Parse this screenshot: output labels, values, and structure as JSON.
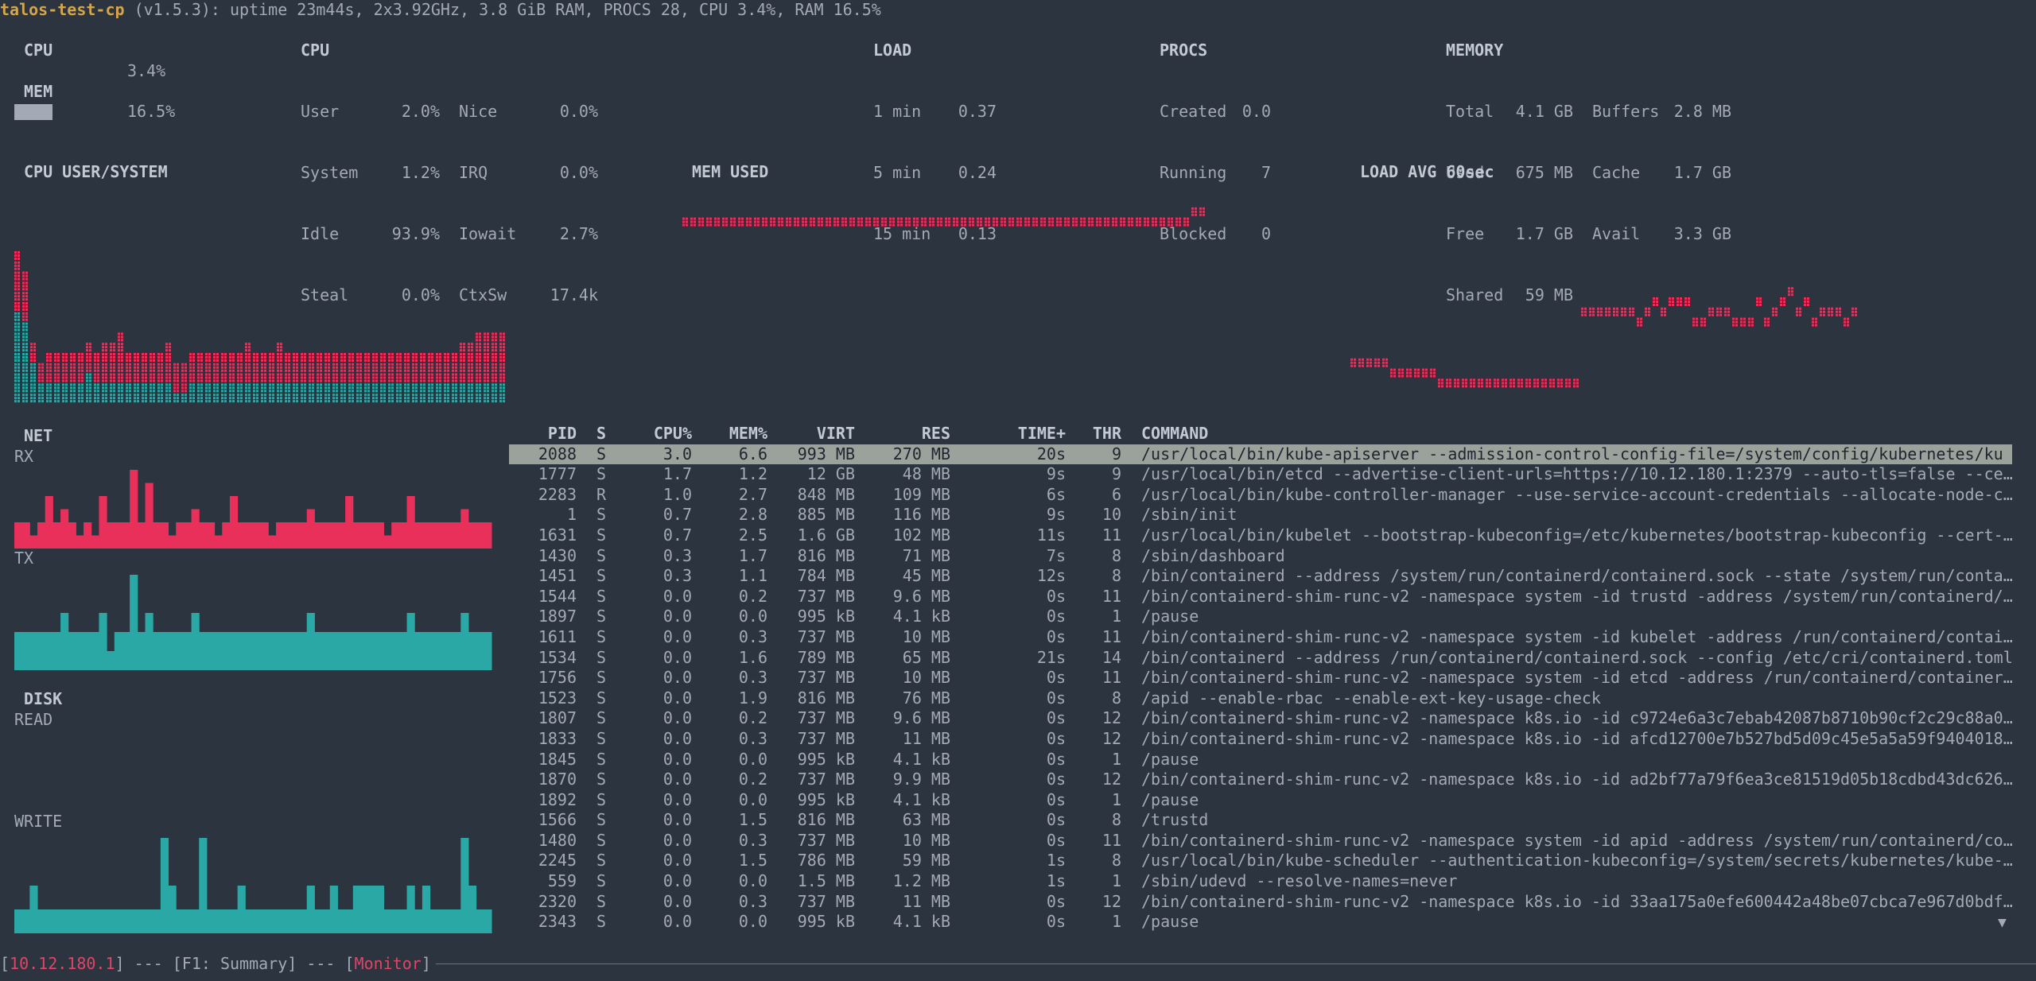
{
  "header": {
    "hostname": "talos-test-cp",
    "summary": " (v1.5.3): uptime 23m44s, 2x3.92GHz, 3.8 GiB RAM, PROCS 28, CPU 3.4%, RAM 16.5%"
  },
  "summary_cpu": {
    "title": "CPU",
    "value": "3.4%",
    "mem_title": "MEM",
    "mem_value": "16.5%",
    "mem_fill": 0.165
  },
  "cpu": {
    "title": "CPU",
    "rows": [
      {
        "l1": "User",
        "v1": "2.0%",
        "l2": "Nice",
        "v2": "0.0%"
      },
      {
        "l1": "System",
        "v1": "1.2%",
        "l2": "IRQ",
        "v2": "0.0%"
      },
      {
        "l1": "Idle",
        "v1": "93.9%",
        "l2": "Iowait",
        "v2": "2.7%"
      },
      {
        "l1": "Steal",
        "v1": "0.0%",
        "l2": "CtxSw",
        "v2": "17.4k"
      }
    ]
  },
  "load": {
    "title": "LOAD",
    "rows": [
      {
        "l": "1 min",
        "v": "0.37"
      },
      {
        "l": "5 min",
        "v": "0.24"
      },
      {
        "l": "15 min",
        "v": "0.13"
      }
    ]
  },
  "procs": {
    "title": "PROCS",
    "rows": [
      {
        "l": "Created",
        "v": "0.0"
      },
      {
        "l": "Running",
        "v": "7"
      },
      {
        "l": "Blocked",
        "v": "0"
      }
    ]
  },
  "memory": {
    "title": "MEMORY",
    "rows": [
      {
        "l1": "Total",
        "v1": "4.1 GB",
        "l2": "Buffers",
        "v2": "2.8 MB"
      },
      {
        "l1": "Used",
        "v1": "675 MB",
        "l2": "Cache",
        "v2": "1.7 GB"
      },
      {
        "l1": "Free",
        "v1": "1.7 GB",
        "l2": "Avail",
        "v2": "3.3 GB"
      },
      {
        "l1": "Shared",
        "v1": "59 MB",
        "l2": "",
        "v2": ""
      }
    ]
  },
  "graphs": {
    "cpu_title": "CPU USER/SYSTEM",
    "mem_title": "MEM USED",
    "load_title": "LOAD AVG 60sec",
    "net_title": "NET",
    "rx_label": "RX",
    "tx_label": "TX",
    "disk_title": "DISK",
    "read_label": "READ",
    "write_label": "WRITE",
    "colors": {
      "red": "#e8305a",
      "teal": "#2aa8a5"
    },
    "cpu_user": [
      6,
      5,
      2,
      2,
      3,
      3,
      3,
      3,
      3,
      3,
      3,
      4,
      4,
      5,
      3,
      3,
      3,
      3,
      3,
      4,
      3,
      3,
      3,
      3,
      3,
      3,
      3,
      3,
      3,
      4,
      3,
      3,
      3,
      4,
      3,
      3,
      3,
      3,
      3,
      3,
      3,
      3,
      3,
      3,
      3,
      3,
      3,
      3,
      3,
      3,
      3,
      3,
      3,
      3,
      3,
      3,
      4,
      4,
      5,
      5,
      5,
      5
    ],
    "cpu_system": [
      9,
      8,
      4,
      2,
      2,
      2,
      2,
      2,
      2,
      3,
      2,
      2,
      2,
      2,
      2,
      2,
      2,
      2,
      2,
      2,
      1,
      1,
      2,
      2,
      2,
      2,
      2,
      2,
      2,
      2,
      2,
      2,
      2,
      2,
      2,
      2,
      2,
      2,
      2,
      2,
      2,
      2,
      2,
      2,
      2,
      2,
      2,
      2,
      2,
      2,
      2,
      2,
      2,
      2,
      2,
      2,
      2,
      2,
      2,
      2,
      2,
      2
    ],
    "mem_used": [
      8,
      8,
      8,
      8,
      8,
      8,
      8,
      8,
      8,
      8,
      8,
      8,
      8,
      8,
      8,
      8,
      8,
      8,
      8,
      8,
      8,
      8,
      8,
      8,
      8,
      8,
      8,
      8,
      8,
      8,
      8,
      8,
      8,
      8,
      8,
      8,
      8,
      8,
      8,
      8,
      8,
      8,
      8,
      8,
      8,
      8,
      8,
      8,
      8,
      8,
      8,
      8,
      8,
      8,
      8,
      8,
      8,
      8,
      8,
      8,
      8,
      8,
      8,
      8,
      9,
      9
    ],
    "load_avg": [
      3,
      3,
      3,
      3,
      3,
      2,
      2,
      2,
      2,
      2,
      2,
      1,
      1,
      1,
      1,
      1,
      1,
      1,
      1,
      1,
      1,
      1,
      1,
      1,
      1,
      1,
      1,
      1,
      1,
      8,
      8,
      8,
      8,
      8,
      8,
      8,
      7,
      8,
      9,
      8,
      9,
      9,
      9,
      7,
      7,
      8,
      8,
      8,
      7,
      7,
      7,
      9,
      7,
      8,
      9,
      10,
      8,
      9,
      7,
      8,
      8,
      8,
      7,
      8
    ],
    "net_rx": [
      2,
      2,
      1,
      2,
      4,
      2,
      3,
      2,
      1,
      2,
      1,
      4,
      2,
      2,
      2,
      6,
      2,
      5,
      2,
      2,
      1,
      2,
      2,
      3,
      2,
      2,
      1,
      2,
      4,
      2,
      2,
      2,
      2,
      1,
      2,
      2,
      2,
      2,
      3,
      2,
      2,
      2,
      2,
      4,
      2,
      2,
      2,
      2,
      1,
      2,
      2,
      4,
      2,
      2,
      2,
      2,
      2,
      2,
      3,
      2,
      2,
      2
    ],
    "net_tx": [
      2,
      2,
      2,
      2,
      2,
      2,
      3,
      2,
      2,
      2,
      2,
      3,
      1,
      2,
      2,
      5,
      2,
      3,
      2,
      2,
      2,
      2,
      2,
      3,
      2,
      2,
      2,
      2,
      2,
      2,
      2,
      2,
      2,
      2,
      2,
      2,
      2,
      2,
      3,
      2,
      2,
      2,
      2,
      2,
      2,
      2,
      2,
      2,
      2,
      2,
      2,
      3,
      2,
      2,
      2,
      2,
      2,
      2,
      3,
      2,
      2,
      2
    ],
    "disk_write": [
      1,
      1,
      2,
      1,
      1,
      1,
      1,
      1,
      1,
      1,
      1,
      1,
      1,
      1,
      1,
      1,
      1,
      1,
      1,
      4,
      2,
      1,
      1,
      1,
      4,
      1,
      1,
      1,
      1,
      2,
      1,
      1,
      1,
      1,
      1,
      1,
      1,
      1,
      2,
      1,
      1,
      2,
      1,
      1,
      2,
      2,
      2,
      2,
      1,
      1,
      1,
      2,
      1,
      2,
      1,
      1,
      1,
      1,
      4,
      2,
      1,
      1
    ]
  },
  "process_table": {
    "headers": {
      "pid": "PID",
      "s": "S",
      "cpu": "CPU%",
      "mem": "MEM%",
      "virt": "VIRT",
      "res": "RES",
      "time": "TIME+",
      "thr": "THR",
      "cmd": "COMMAND"
    },
    "rows": [
      {
        "pid": "2088",
        "s": "S",
        "cpu": "3.0",
        "mem": "6.6",
        "virt": "993 MB",
        "res": "270 MB",
        "time": "20s",
        "thr": "9",
        "cmd": "/usr/local/bin/kube-apiserver --admission-control-config-file=/system/config/kubernetes/ku"
      },
      {
        "pid": "1777",
        "s": "S",
        "cpu": "1.7",
        "mem": "1.2",
        "virt": "12 GB",
        "res": "48 MB",
        "time": "9s",
        "thr": "9",
        "cmd": "/usr/local/bin/etcd --advertise-client-urls=https://10.12.180.1:2379 --auto-tls=false --ce…"
      },
      {
        "pid": "2283",
        "s": "R",
        "cpu": "1.0",
        "mem": "2.7",
        "virt": "848 MB",
        "res": "109 MB",
        "time": "6s",
        "thr": "6",
        "cmd": "/usr/local/bin/kube-controller-manager --use-service-account-credentials --allocate-node-c…"
      },
      {
        "pid": "1",
        "s": "S",
        "cpu": "0.7",
        "mem": "2.8",
        "virt": "885 MB",
        "res": "116 MB",
        "time": "9s",
        "thr": "10",
        "cmd": "/sbin/init"
      },
      {
        "pid": "1631",
        "s": "S",
        "cpu": "0.7",
        "mem": "2.5",
        "virt": "1.6 GB",
        "res": "102 MB",
        "time": "11s",
        "thr": "11",
        "cmd": "/usr/local/bin/kubelet --bootstrap-kubeconfig=/etc/kubernetes/bootstrap-kubeconfig --cert-…"
      },
      {
        "pid": "1430",
        "s": "S",
        "cpu": "0.3",
        "mem": "1.7",
        "virt": "816 MB",
        "res": "71 MB",
        "time": "7s",
        "thr": "8",
        "cmd": "/sbin/dashboard"
      },
      {
        "pid": "1451",
        "s": "S",
        "cpu": "0.3",
        "mem": "1.1",
        "virt": "784 MB",
        "res": "45 MB",
        "time": "12s",
        "thr": "8",
        "cmd": "/bin/containerd --address /system/run/containerd/containerd.sock --state /system/run/conta…"
      },
      {
        "pid": "1544",
        "s": "S",
        "cpu": "0.0",
        "mem": "0.2",
        "virt": "737 MB",
        "res": "9.6 MB",
        "time": "0s",
        "thr": "11",
        "cmd": "/bin/containerd-shim-runc-v2 -namespace system -id trustd -address /system/run/containerd/…"
      },
      {
        "pid": "1897",
        "s": "S",
        "cpu": "0.0",
        "mem": "0.0",
        "virt": "995 kB",
        "res": "4.1 kB",
        "time": "0s",
        "thr": "1",
        "cmd": "/pause"
      },
      {
        "pid": "1611",
        "s": "S",
        "cpu": "0.0",
        "mem": "0.3",
        "virt": "737 MB",
        "res": "10 MB",
        "time": "0s",
        "thr": "11",
        "cmd": "/bin/containerd-shim-runc-v2 -namespace system -id kubelet -address /run/containerd/contai…"
      },
      {
        "pid": "1534",
        "s": "S",
        "cpu": "0.0",
        "mem": "1.6",
        "virt": "789 MB",
        "res": "65 MB",
        "time": "21s",
        "thr": "14",
        "cmd": "/bin/containerd --address /run/containerd/containerd.sock --config /etc/cri/containerd.toml"
      },
      {
        "pid": "1756",
        "s": "S",
        "cpu": "0.0",
        "mem": "0.3",
        "virt": "737 MB",
        "res": "10 MB",
        "time": "0s",
        "thr": "11",
        "cmd": "/bin/containerd-shim-runc-v2 -namespace system -id etcd -address /run/containerd/container…"
      },
      {
        "pid": "1523",
        "s": "S",
        "cpu": "0.0",
        "mem": "1.9",
        "virt": "816 MB",
        "res": "76 MB",
        "time": "0s",
        "thr": "8",
        "cmd": "/apid --enable-rbac --enable-ext-key-usage-check"
      },
      {
        "pid": "1807",
        "s": "S",
        "cpu": "0.0",
        "mem": "0.2",
        "virt": "737 MB",
        "res": "9.6 MB",
        "time": "0s",
        "thr": "12",
        "cmd": "/bin/containerd-shim-runc-v2 -namespace k8s.io -id c9724e6a3c7ebab42087b8710b90cf2c29c88a0…"
      },
      {
        "pid": "1833",
        "s": "S",
        "cpu": "0.0",
        "mem": "0.3",
        "virt": "737 MB",
        "res": "11 MB",
        "time": "0s",
        "thr": "12",
        "cmd": "/bin/containerd-shim-runc-v2 -namespace k8s.io -id afcd12700e7b527bd5d09c45e5a5a59f9404018…"
      },
      {
        "pid": "1845",
        "s": "S",
        "cpu": "0.0",
        "mem": "0.0",
        "virt": "995 kB",
        "res": "4.1 kB",
        "time": "0s",
        "thr": "1",
        "cmd": "/pause"
      },
      {
        "pid": "1870",
        "s": "S",
        "cpu": "0.0",
        "mem": "0.2",
        "virt": "737 MB",
        "res": "9.9 MB",
        "time": "0s",
        "thr": "12",
        "cmd": "/bin/containerd-shim-runc-v2 -namespace k8s.io -id ad2bf77a79f6ea3ce81519d05b18cdbd43dc626…"
      },
      {
        "pid": "1892",
        "s": "S",
        "cpu": "0.0",
        "mem": "0.0",
        "virt": "995 kB",
        "res": "4.1 kB",
        "time": "0s",
        "thr": "1",
        "cmd": "/pause"
      },
      {
        "pid": "1566",
        "s": "S",
        "cpu": "0.0",
        "mem": "1.5",
        "virt": "816 MB",
        "res": "63 MB",
        "time": "0s",
        "thr": "8",
        "cmd": "/trustd"
      },
      {
        "pid": "1480",
        "s": "S",
        "cpu": "0.0",
        "mem": "0.3",
        "virt": "737 MB",
        "res": "10 MB",
        "time": "0s",
        "thr": "11",
        "cmd": "/bin/containerd-shim-runc-v2 -namespace system -id apid -address /system/run/containerd/co…"
      },
      {
        "pid": "2245",
        "s": "S",
        "cpu": "0.0",
        "mem": "1.5",
        "virt": "786 MB",
        "res": "59 MB",
        "time": "1s",
        "thr": "8",
        "cmd": "/usr/local/bin/kube-scheduler --authentication-kubeconfig=/system/secrets/kubernetes/kube-…"
      },
      {
        "pid": "559",
        "s": "S",
        "cpu": "0.0",
        "mem": "0.0",
        "virt": "1.5 MB",
        "res": "1.2 MB",
        "time": "1s",
        "thr": "1",
        "cmd": "/sbin/udevd --resolve-names=never"
      },
      {
        "pid": "2320",
        "s": "S",
        "cpu": "0.0",
        "mem": "0.3",
        "virt": "737 MB",
        "res": "11 MB",
        "time": "0s",
        "thr": "12",
        "cmd": "/bin/containerd-shim-runc-v2 -namespace k8s.io -id 33aa175a0efe600442a48be07cbca7e967d0bdf…"
      },
      {
        "pid": "2343",
        "s": "S",
        "cpu": "0.0",
        "mem": "0.0",
        "virt": "995 kB",
        "res": "4.1 kB",
        "time": "0s",
        "thr": "1",
        "cmd": "/pause"
      }
    ],
    "scroll_indicator": "▼"
  },
  "footer": {
    "node": "10.12.180.1",
    "sep1": "] --- [",
    "screen": "F1: Summary",
    "sep2": "] --- [",
    "mode": "Monitor",
    "end": "]"
  }
}
